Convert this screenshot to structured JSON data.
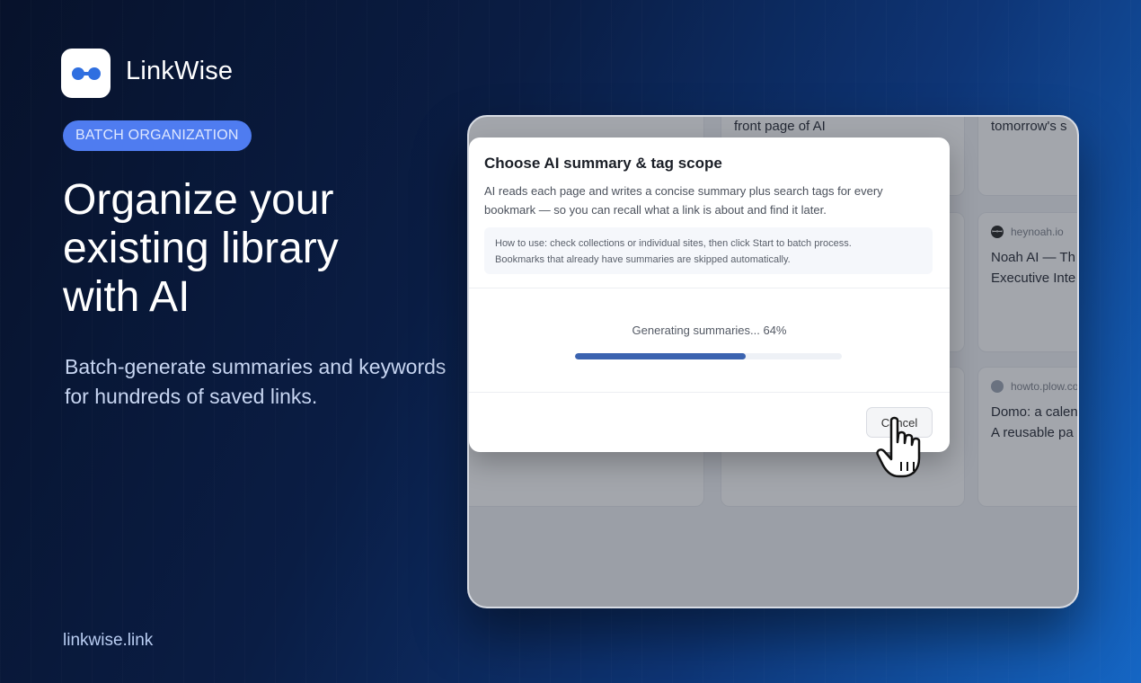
{
  "brand": {
    "name": "LinkWise",
    "logo_icon": "infinity-link-icon"
  },
  "badge": "BATCH ORGANIZATION",
  "headline": [
    "Organize your",
    "existing library",
    "with AI"
  ],
  "subhead": [
    "Batch-generate summaries and keywords",
    "for hundreds of saved links."
  ],
  "site_url": "linkwise.link",
  "cards": [
    {
      "title": [
        "front page of AI"
      ]
    },
    {
      "title": [
        "tomorrow's s"
      ]
    },
    {
      "source": "heynoah.io",
      "title": [
        "Noah AI — Th",
        "Executive Inte"
      ]
    },
    {
      "source": "howto.plow.co",
      "title": [
        "Domo: a calen",
        "A reusable pa"
      ]
    }
  ],
  "modal": {
    "title": "Choose AI summary & tag scope",
    "description": [
      "AI reads each page and writes a concise summary plus search tags for every",
      "bookmark — so you can recall what a link is about and find it later."
    ],
    "help": [
      "How to use: check collections or individual sites, then click Start to batch process.",
      "Bookmarks that already have summaries are skipped automatically."
    ],
    "progress_label": "Generating summaries... 64%",
    "progress_fraction": 0.64,
    "cancel_label": "Cancel"
  },
  "colors": {
    "accent": "#4f7cf0",
    "progress": "#3b63b0"
  }
}
